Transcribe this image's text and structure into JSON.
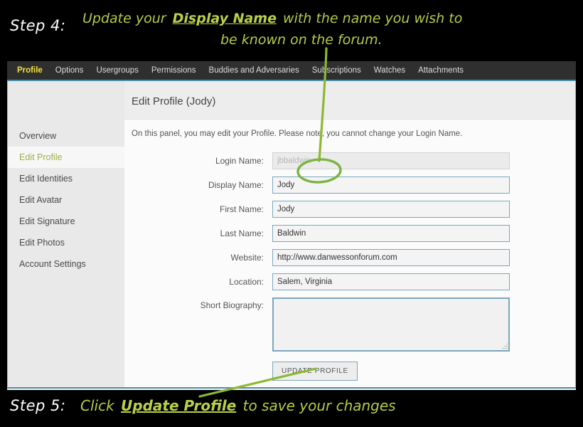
{
  "annotations": {
    "step4_label": "Step 4:",
    "step4_text_line1_a": "Update your ",
    "step4_text_line1_em": "Display Name",
    "step4_text_line1_b": " with the name you wish to",
    "step4_text_line2": "be known on the forum.",
    "step5_label": "Step 5:",
    "step5_text_a": "Click ",
    "step5_text_em": "Update Profile",
    "step5_text_b": " to save your changes",
    "accent_green": "#b4cc45",
    "marker_green": "#7cb342",
    "label_white": "#ffffff"
  },
  "navbar": {
    "tabs": [
      {
        "label": "Profile",
        "active": true
      },
      {
        "label": "Options",
        "active": false
      },
      {
        "label": "Usergroups",
        "active": false
      },
      {
        "label": "Permissions",
        "active": false
      },
      {
        "label": "Buddies and Adversaries",
        "active": false
      },
      {
        "label": "Subscriptions",
        "active": false
      },
      {
        "label": "Watches",
        "active": false
      },
      {
        "label": "Attachments",
        "active": false
      }
    ],
    "active_color": "#f2e33a",
    "background": "#2f2f2f"
  },
  "sidebar": {
    "items": [
      {
        "label": "Overview",
        "active": false
      },
      {
        "label": "Edit Profile",
        "active": true
      },
      {
        "label": "Edit Identities",
        "active": false
      },
      {
        "label": "Edit Avatar",
        "active": false
      },
      {
        "label": "Edit Signature",
        "active": false
      },
      {
        "label": "Edit Photos",
        "active": false
      },
      {
        "label": "Account Settings",
        "active": false
      }
    ],
    "active_color": "#9fb04d"
  },
  "content": {
    "title": "Edit Profile (Jody)",
    "description": "On this panel, you may edit your Profile. Please note, you cannot change your Login Name.",
    "fields": [
      {
        "label": "Login Name:",
        "value": "jbbaldwin",
        "type": "text",
        "disabled": true
      },
      {
        "label": "Display Name:",
        "value": "Jody",
        "type": "text",
        "disabled": false
      },
      {
        "label": "First Name:",
        "value": "Jody",
        "type": "text",
        "disabled": false
      },
      {
        "label": "Last Name:",
        "value": "Baldwin",
        "type": "text",
        "disabled": false
      },
      {
        "label": "Website:",
        "value": "http://www.danwessonforum.com",
        "type": "text",
        "disabled": false
      },
      {
        "label": "Location:",
        "value": "Salem, Virginia",
        "type": "text",
        "disabled": false
      },
      {
        "label": "Short Biography:",
        "value": "",
        "type": "textarea",
        "disabled": false
      }
    ],
    "submit_label": "UPDATE PROFILE"
  }
}
